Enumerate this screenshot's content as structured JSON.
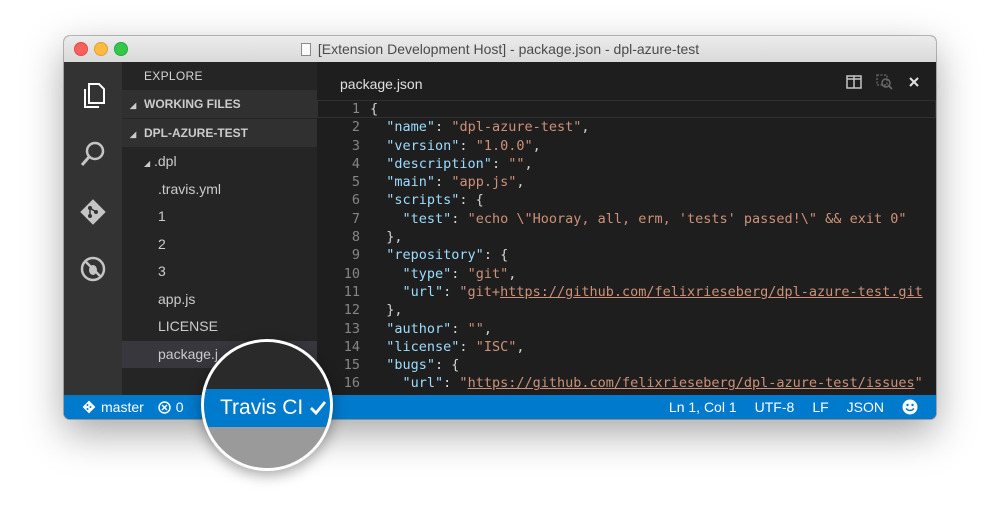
{
  "window": {
    "title": "[Extension Development Host] - package.json - dpl-azure-test"
  },
  "activity_bar": {
    "icons": [
      "files-icon",
      "search-icon",
      "git-icon",
      "debug-icon"
    ]
  },
  "sidebar": {
    "header": "EXPLORE",
    "working_files_label": "WORKING FILES",
    "project_label": "DPL-AZURE-TEST",
    "items": [
      {
        "label": ".dpl"
      },
      {
        "label": ".travis.yml"
      },
      {
        "label": "1"
      },
      {
        "label": "2"
      },
      {
        "label": "3"
      },
      {
        "label": "app.js"
      },
      {
        "label": "LICENSE"
      },
      {
        "label": "package.j"
      }
    ]
  },
  "editor": {
    "tab_label": "package.json",
    "line_numbers": [
      "1",
      "2",
      "3",
      "4",
      "5",
      "6",
      "7",
      "8",
      "9",
      "10",
      "11",
      "12",
      "13",
      "14",
      "15",
      "16"
    ],
    "lines": [
      "{",
      "  \"name\": \"dpl-azure-test\",",
      "  \"version\": \"1.0.0\",",
      "  \"description\": \"\",",
      "  \"main\": \"app.js\",",
      "  \"scripts\": {",
      "    \"test\": \"echo \\\"Hooray, all, erm, 'tests' passed!\\\" && exit 0\"",
      "  },",
      "  \"repository\": {",
      "    \"type\": \"git\",",
      "    \"url\": \"git+https://github.com/felixrieseberg/dpl-azure-test.git",
      "  },",
      "  \"author\": \"\",",
      "  \"license\": \"ISC\",",
      "  \"bugs\": {",
      "    \"url\": \"https://github.com/felixrieseberg/dpl-azure-test/issues\""
    ]
  },
  "status_bar": {
    "branch": "master",
    "errors": "0",
    "cursor_position": "Ln 1, Col 1",
    "encoding": "UTF-8",
    "line_ending": "LF",
    "language": "JSON"
  },
  "magnifier": {
    "label": "Travis CI"
  },
  "colors": {
    "status_bar": "#007acc",
    "json_key": "#9cdcfe",
    "json_string": "#ce9178"
  }
}
